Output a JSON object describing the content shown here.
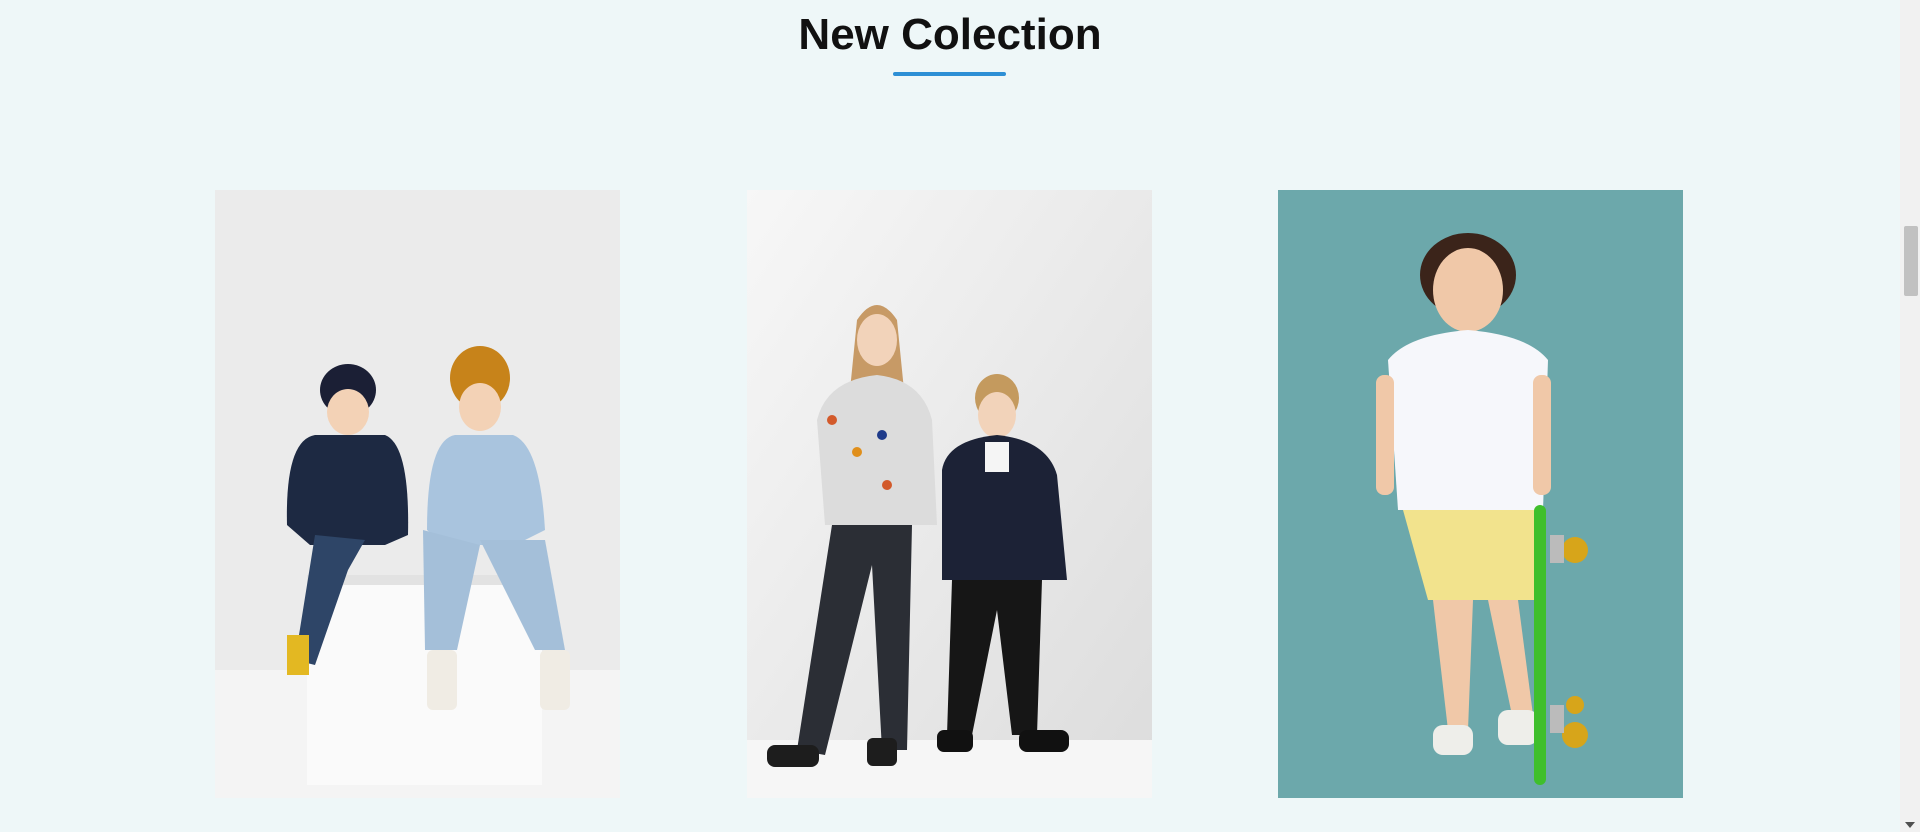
{
  "section": {
    "title": "New Colection",
    "accent_color": "#2d8fd5"
  },
  "products": [
    {
      "image": "two-kids-sitting-on-white-cube",
      "background": "#ececec"
    },
    {
      "image": "girl-and-boy-standing-against-white-wall",
      "background": "#f2f2f2"
    },
    {
      "image": "boy-with-green-skateboard",
      "background": "#6fa9ac"
    }
  ]
}
